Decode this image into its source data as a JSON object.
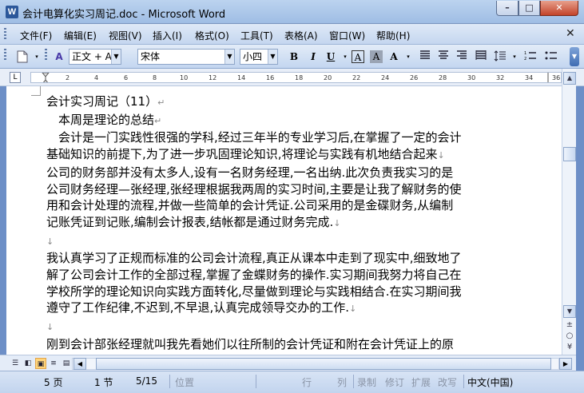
{
  "window": {
    "title": "会计电算化实习周记.doc - Microsoft Word",
    "app_icon": "W",
    "minimize": "–",
    "maximize": "□",
    "close": "✕"
  },
  "menu": {
    "items": [
      "文件(F)",
      "编辑(E)",
      "视图(V)",
      "插入(I)",
      "格式(O)",
      "工具(T)",
      "表格(A)",
      "窗口(W)",
      "帮助(H)"
    ],
    "close_doc": "✕"
  },
  "toolbar": {
    "style": "正文 + Aria",
    "font": "宋体",
    "size": "小四",
    "bold": "B",
    "italic": "I",
    "underline": "U",
    "char_border": "A",
    "char_shading": "A",
    "text_effects": "A"
  },
  "ruler": {
    "corner": "L",
    "ticks": [
      "2",
      "4",
      "6",
      "8",
      "10",
      "12",
      "14",
      "16",
      "18",
      "20",
      "22",
      "24",
      "26",
      "28",
      "30",
      "32",
      "34",
      "36"
    ]
  },
  "document": {
    "lines": [
      "会计实习周记（11）",
      "　本周是理论的总结",
      "　会计是一门实践性很强的学科,经过三年半的专业学习后,在掌握了一定的会计",
      "基础知识的前提下,为了进一步巩固理论知识,将理论与实践有机地结合起来",
      "公司的财务部并没有太多人,设有一名财务经理,一名出纳.此次负责我实习的是",
      "公司财务经理—张经理,张经理根据我两周的实习时间,主要是让我了解财务的使",
      "用和会计处理的流程,并做一些简单的会计凭证.公司采用的是金碟财务,从编制",
      "记账凭证到记账,编制会计报表,结帐都是通过财务完成.",
      "",
      "我认真学习了正规而标准的公司会计流程,真正从课本中走到了现实中,细致地了",
      "解了公司会计工作的全部过程,掌握了金蝶财务的操作.实习期间我努力将自己在",
      "学校所学的理论知识向实践方面转化,尽量做到理论与实践相结合.在实习期间我",
      "遵守了工作纪律,不迟到,不早退,认真完成领导交办的工作.",
      "",
      "刚到会计部张经理就叫我先看她们以往所制的会计凭证和附在会计凭证上的原"
    ],
    "para_marks": [
      "↵",
      "↵",
      "",
      "↓",
      "",
      "",
      "",
      "↓",
      "↓",
      "",
      "",
      "",
      "↓",
      "↓",
      ""
    ]
  },
  "statusbar": {
    "page": "5 页",
    "section": "1 节",
    "page_of": "5/15",
    "position": "位置",
    "line": "行",
    "column": "列",
    "rec": "录制",
    "trk": "修订",
    "ext": "扩展",
    "ovr": "改写",
    "language": "中文(中国)"
  }
}
